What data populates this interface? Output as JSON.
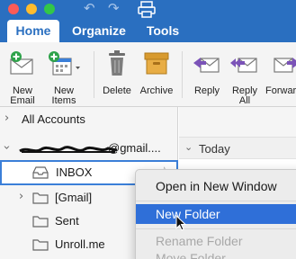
{
  "tabs": {
    "home": "Home",
    "organize": "Organize",
    "tools": "Tools"
  },
  "ribbon": {
    "new_email": "New\nEmail",
    "new_items": "New\nItems",
    "delete": "Delete",
    "archive": "Archive",
    "reply": "Reply",
    "reply_all": "Reply\nAll",
    "forward": "Forwar"
  },
  "folders": {
    "all_accounts": "All Accounts",
    "account": "@gmail....",
    "inbox": "INBOX",
    "gmail": "[Gmail]",
    "sent": "Sent",
    "unroll": "Unroll.me"
  },
  "list": {
    "group_today": "Today"
  },
  "context_menu": {
    "open_new_window": "Open in New Window",
    "new_folder": "New Folder",
    "rename_folder": "Rename Folder",
    "move_folder": "Move Folder"
  },
  "colors": {
    "accent": "#2a6fc0",
    "highlight": "#2f6fd8"
  }
}
